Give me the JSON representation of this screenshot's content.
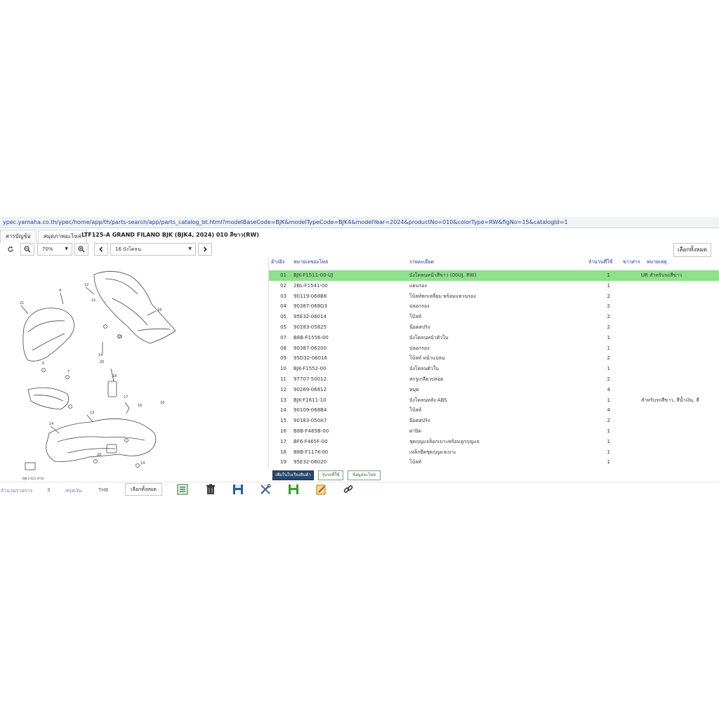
{
  "browser": {
    "url": "ypec.yamaha.co.th/ypec/home/app/th/parts-search/app/parts_catalog_bt.html?modelBaseCode=BJK&modelTypeCode=BJK4&modelYear=2024&productNo=010&colorType=RW&figNo=15&catalogId=1"
  },
  "tabs": [
    {
      "label": "สารบัญข้อ"
    },
    {
      "label": "สมุดภาพอะไหล่"
    }
  ],
  "model_title": "LTF125-A GRAND FILANO BJK (BJK4, 2024) 010 สีขาว(RW)",
  "toolbar": {
    "zoom": "70%",
    "figure": "16 บังโคลน",
    "select_all": "เลือกทั้งหมด"
  },
  "diagram": {
    "code_label": "BJK-1-021-1F02"
  },
  "table": {
    "headers": {
      "idx": "อ้างอิง",
      "part_no": "หมายเลขอะไหล่",
      "desc": "รายละเอียด",
      "qty": "จำนวนที่ใช้",
      "stock": "ขาวสาร",
      "note": "หมายเหตุ"
    },
    "rows": [
      {
        "idx": "01",
        "part_no": "BJK-F1511-00-UJ",
        "desc": "บังโคลนหน้าสีขาว (00UJ, RW)",
        "qty": "1",
        "note": "UR สำหรับรถสีขาว"
      },
      {
        "idx": "02",
        "part_no": "2BL-F1541-00",
        "desc": "แผ่นรอง",
        "qty": "1",
        "note": ""
      },
      {
        "idx": "03",
        "part_no": "90119-068B6",
        "desc": "โบ้ลท์หกเหลี่ยม พร้อมแหวนรอง",
        "qty": "2",
        "note": ""
      },
      {
        "idx": "04",
        "part_no": "90387-068G3",
        "desc": "ปลอกรอง",
        "qty": "2",
        "note": ""
      },
      {
        "idx": "05",
        "part_no": "95E32-06014",
        "desc": "โบ้ลท์",
        "qty": "2",
        "note": ""
      },
      {
        "idx": "05",
        "part_no": "90183-05825",
        "desc": "น๊อตสปริง",
        "qty": "2",
        "note": ""
      },
      {
        "idx": "07",
        "part_no": "B8B-F1556-00",
        "desc": "บังโคลนหน้าตัวใน",
        "qty": "1",
        "note": ""
      },
      {
        "idx": "08",
        "part_no": "90387-06200",
        "desc": "ปลอกรอง",
        "qty": "1",
        "note": ""
      },
      {
        "idx": "09",
        "part_no": "95D32-06016",
        "desc": "โบ้ลท์ หน้าแปลน",
        "qty": "2",
        "note": ""
      },
      {
        "idx": "10",
        "part_no": "BJK-F1552-00",
        "desc": "บังโคลนตัวใน",
        "qty": "1",
        "note": ""
      },
      {
        "idx": "11",
        "part_no": "97707-50012",
        "desc": "สกรูเกลียวปล่อย",
        "qty": "2",
        "note": ""
      },
      {
        "idx": "12",
        "part_no": "90269-06812",
        "desc": "หมุด",
        "qty": "4",
        "note": ""
      },
      {
        "idx": "13",
        "part_no": "BJK-F1611-10",
        "desc": "บังโคลนหลัง ABS",
        "qty": "1",
        "note": "สำหรับรถสีขาว, สีน้ำเงิน, สี"
      },
      {
        "idx": "14",
        "part_no": "90109-068B4",
        "desc": "โบ้ลท์",
        "qty": "4",
        "note": ""
      },
      {
        "idx": "15",
        "part_no": "90183-050A7",
        "desc": "น๊อตสปริง",
        "qty": "2",
        "note": ""
      },
      {
        "idx": "16",
        "part_no": "B8B-F465B-00",
        "desc": "ฝาปิด",
        "qty": "1",
        "note": ""
      },
      {
        "idx": "17",
        "part_no": "BF6-F465F-00",
        "desc": "ชุดกุญแจล็อกเบาะพร้อมลูกกุญแจ",
        "qty": "1",
        "note": ""
      },
      {
        "idx": "18",
        "part_no": "B8B-F117K-00",
        "desc": "เหล็กยึดชุดกุญแจเบาะ",
        "qty": "1",
        "note": ""
      },
      {
        "idx": "19",
        "part_no": "95E32-06020",
        "desc": "โบ้ลท์",
        "qty": "1",
        "note": ""
      }
    ]
  },
  "actions": {
    "add_to_cart": "เพิ่มในใบเรียงสินค้า",
    "model_usage": "รุ่นรถที่ใช้",
    "part_info": "ข้อมูลอะไหล่"
  },
  "footer": {
    "count_label": "จำนวนรายการ",
    "count_value": "3",
    "currency_label": "สกุลเงิน",
    "currency_value": "THB",
    "select_all": "เลือกทั้งหมด"
  },
  "colors": {
    "selected_row": "#8ee08a",
    "header_text": "#6a73c8",
    "primary_button": "#28466e"
  }
}
